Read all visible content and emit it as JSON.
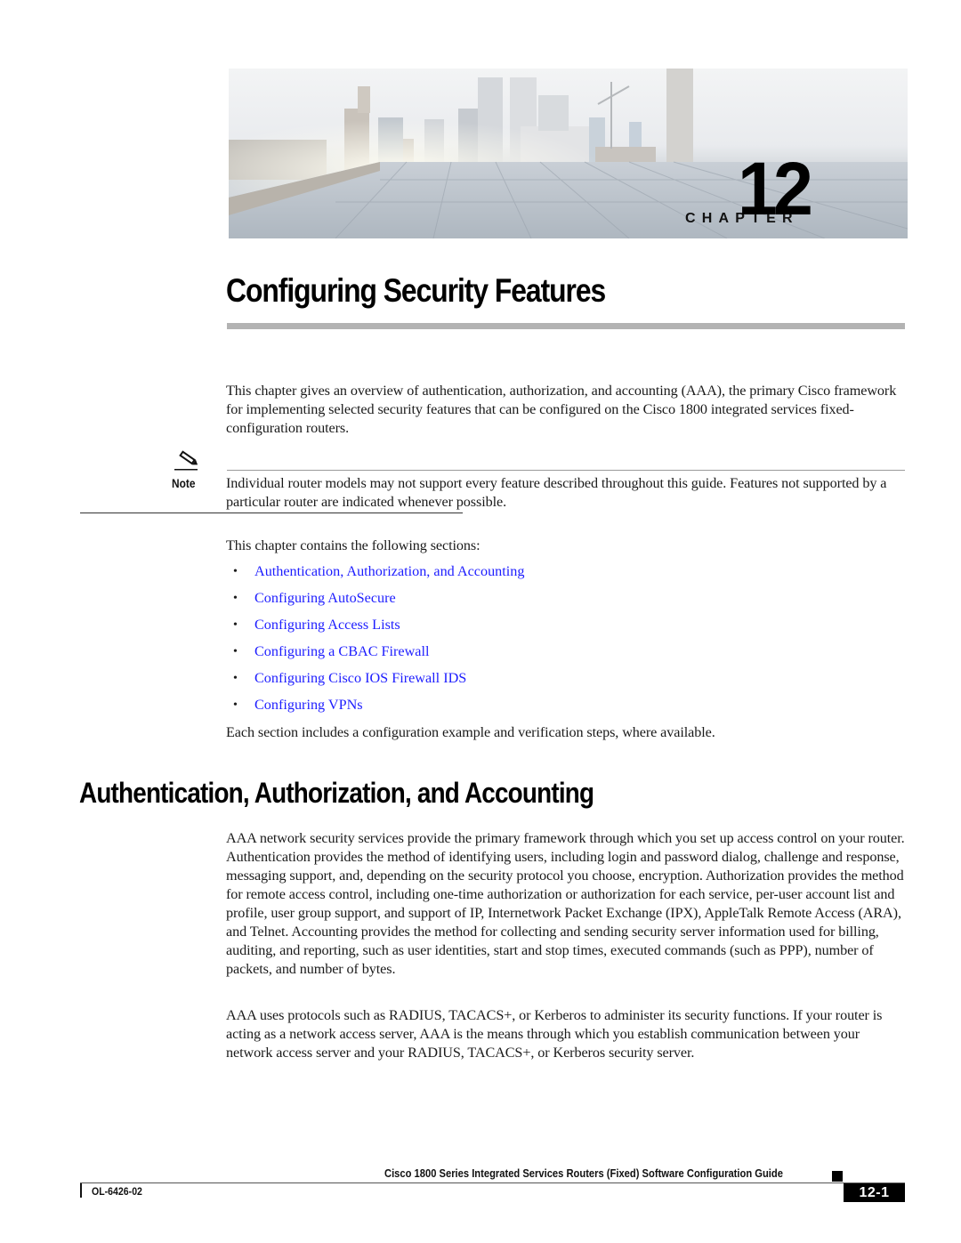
{
  "banner": {
    "chapter_word": "CHAPTER",
    "chapter_number": "12",
    "image_description": "city-skyline-rooftop-photo"
  },
  "title": "Configuring Security Features",
  "intro_paragraph": "This chapter gives an overview of authentication, authorization, and accounting (AAA), the primary Cisco framework for implementing selected security features that can be configured on the Cisco 1800 integrated services fixed-configuration routers.",
  "note": {
    "label": "Note",
    "icon": "pencil-note-icon",
    "text": "Individual router models may not support every feature described throughout this guide. Features not supported by a particular router are indicated whenever possible."
  },
  "sections_intro": "This chapter contains the following sections:",
  "sections": [
    {
      "label": "Authentication, Authorization, and Accounting"
    },
    {
      "label": "Configuring AutoSecure"
    },
    {
      "label": "Configuring Access Lists"
    },
    {
      "label": "Configuring a CBAC Firewall"
    },
    {
      "label": "Configuring Cisco IOS Firewall IDS"
    },
    {
      "label": "Configuring VPNs"
    }
  ],
  "sections_outro": "Each section includes a configuration example and verification steps, where available.",
  "aaa_section": {
    "heading": "Authentication, Authorization, and Accounting",
    "paragraphs": [
      "AAA network security services provide the primary framework through which you set up access control on your router. Authentication provides the method of identifying users, including login and password dialog, challenge and response, messaging support, and, depending on the security protocol you choose, encryption. Authorization provides the method for remote access control, including one-time authorization or authorization for each service, per-user account list and profile, user group support, and support of IP, Internetwork Packet Exchange (IPX), AppleTalk Remote Access (ARA), and Telnet. Accounting provides the method for collecting and sending security server information used for billing, auditing, and reporting, such as user identities, start and stop times, executed commands (such as PPP), number of packets, and number of bytes.",
      "AAA uses protocols such as RADIUS, TACACS+, or Kerberos to administer its security functions. If your router is acting as a network access server, AAA is the means through which you establish communication between your network access server and your RADIUS, TACACS+, or Kerberos security server."
    ]
  },
  "footer": {
    "guide_title": "Cisco 1800 Series Integrated Services Routers (Fixed) Software Configuration Guide",
    "doc_number": "OL-6426-02",
    "page_number": "12-1"
  },
  "colors": {
    "link": "#1d1dff",
    "rule_gray": "#b3b3b3",
    "text": "#1a1a1a"
  }
}
